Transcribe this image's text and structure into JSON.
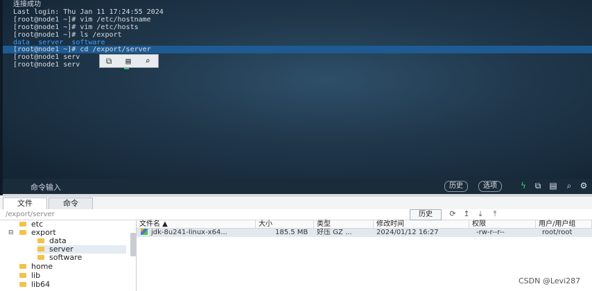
{
  "terminal": {
    "lines": [
      "连接成功",
      "Last login: Thu Jan 11 17:24:55 2024",
      "[root@node1 ~]# vim /etc/hostname",
      "[root@node1 ~]# vim /etc/hosts",
      "[root@node1 ~]# ls /export"
    ],
    "ls_output": [
      "data",
      "server",
      "software"
    ],
    "cd_line": "[root@node1 ~]# cd /export/server",
    "line_after_1": "[root@node1 serv",
    "line_after_2": "[root@node1 serv"
  },
  "context_menu": {
    "icons": [
      "copy-icon",
      "paste-icon",
      "search-icon"
    ]
  },
  "command_bar": {
    "label": "命令输入",
    "history_button": "历史",
    "options_button": "选项",
    "icons": [
      "lightning-icon",
      "copy-icon",
      "paste-icon",
      "search-icon",
      "gear-icon"
    ]
  },
  "tabs": [
    {
      "label": "文件",
      "active": true
    },
    {
      "label": "命令",
      "active": false
    }
  ],
  "path_bar": {
    "path": "/export/server",
    "history_button": "历史",
    "icons": [
      "refresh-icon",
      "up-icon",
      "download-icon",
      "upload-icon"
    ]
  },
  "tree": [
    {
      "label": "etc",
      "depth": 1,
      "expanded": false,
      "selected": false
    },
    {
      "label": "export",
      "depth": 1,
      "expanded": true,
      "selected": false
    },
    {
      "label": "data",
      "depth": 2,
      "expanded": false,
      "selected": false
    },
    {
      "label": "server",
      "depth": 2,
      "expanded": false,
      "selected": true
    },
    {
      "label": "software",
      "depth": 2,
      "expanded": false,
      "selected": false
    },
    {
      "label": "home",
      "depth": 1,
      "expanded": false,
      "selected": false
    },
    {
      "label": "lib",
      "depth": 1,
      "expanded": false,
      "selected": false
    },
    {
      "label": "lib64",
      "depth": 1,
      "expanded": false,
      "selected": false
    }
  ],
  "file_table": {
    "columns": [
      "文件名 ▲",
      "大小",
      "类型",
      "修改时间",
      "权限",
      "用户/用户组"
    ],
    "rows": [
      {
        "name": "jdk-8u241-linux-x64...",
        "size": "185.5 MB",
        "type": "好压 GZ ...",
        "modified": "2024/01/12 16:27",
        "permissions": "-rw-r--r--",
        "owner": "root/root"
      }
    ]
  },
  "watermark": "CSDN @Levi287",
  "colors": {
    "terminal_bg": "#20374b",
    "highlight": "#1f5b93",
    "ls_dir": "#3aa0ff",
    "folder": "#f2c24b"
  }
}
